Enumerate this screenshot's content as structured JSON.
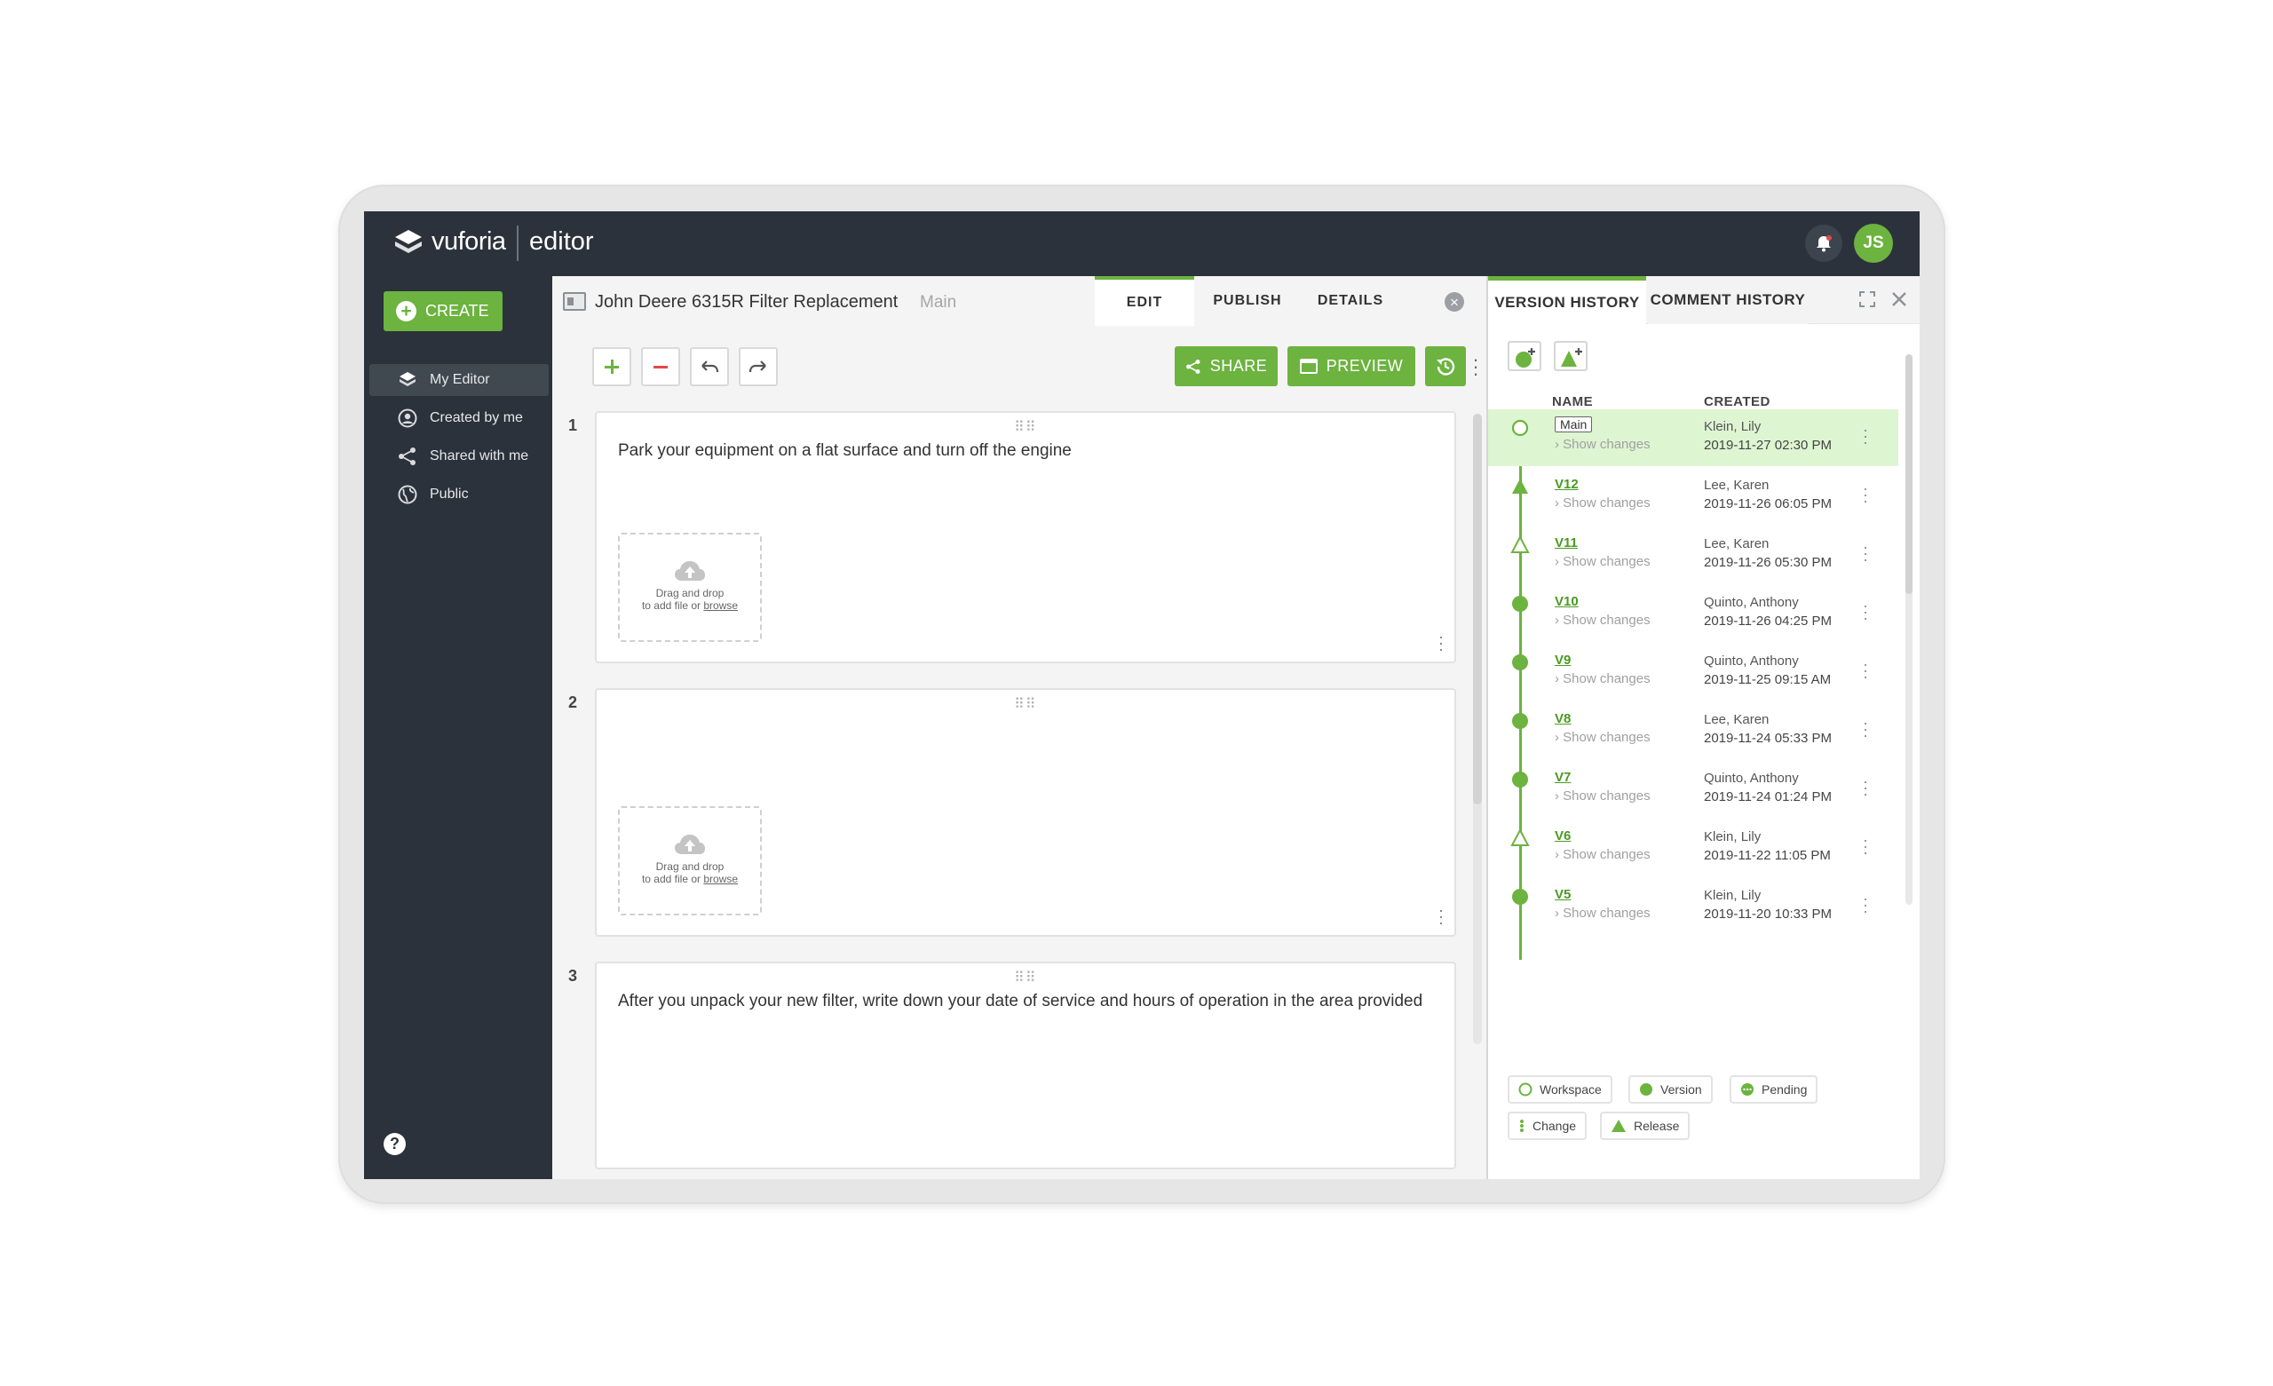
{
  "brand": {
    "name": "vuforia",
    "product": "editor"
  },
  "user": {
    "initials": "JS"
  },
  "colors": {
    "accent": "#6cb33f",
    "topbar": "#2b323b",
    "highlight": "#def5d2"
  },
  "sidebar": {
    "create_label": "CREATE",
    "items": [
      {
        "label": "My Editor",
        "icon": "layers-icon"
      },
      {
        "label": "Created by me",
        "icon": "user-circle-icon"
      },
      {
        "label": "Shared with me",
        "icon": "share-icon"
      },
      {
        "label": "Public",
        "icon": "globe-icon"
      }
    ],
    "help_label": "?"
  },
  "document": {
    "title": "John Deere 6315R Filter Replacement",
    "branch": "Main",
    "tabs": [
      "EDIT",
      "PUBLISH",
      "DETAILS"
    ],
    "actions": {
      "share": "SHARE",
      "preview": "PREVIEW"
    }
  },
  "steps": [
    {
      "number": "1",
      "text": "Park your equipment on a flat surface and turn off the engine",
      "dropzone": true
    },
    {
      "number": "2",
      "text": "",
      "dropzone": true
    },
    {
      "number": "3",
      "text": "After you unpack your new filter, write down your date of service and hours of operation in the area provided",
      "dropzone": false
    }
  ],
  "dropzone": {
    "line1": "Drag and drop",
    "line2": "to add file or",
    "link": "browse"
  },
  "history": {
    "tabs": [
      "VERSION HISTORY",
      "COMMENT HISTORY"
    ],
    "columns": {
      "name": "NAME",
      "created": "CREATED"
    },
    "show_changes": "Show changes",
    "versions": [
      {
        "name": "Main",
        "type": "workspace",
        "author": "Klein, Lily",
        "date": "2019-11-27 02:30 PM"
      },
      {
        "name": "V12",
        "type": "release-filled",
        "author": "Lee, Karen",
        "date": "2019-11-26 06:05 PM"
      },
      {
        "name": "V11",
        "type": "release-outline",
        "author": "Lee, Karen",
        "date": "2019-11-26 05:30 PM"
      },
      {
        "name": "V10",
        "type": "version",
        "author": "Quinto, Anthony",
        "date": "2019-11-26 04:25 PM"
      },
      {
        "name": "V9",
        "type": "version",
        "author": "Quinto, Anthony",
        "date": "2019-11-25 09:15 AM"
      },
      {
        "name": "V8",
        "type": "version",
        "author": "Lee, Karen",
        "date": "2019-11-24 05:33 PM"
      },
      {
        "name": "V7",
        "type": "version",
        "author": "Quinto, Anthony",
        "date": "2019-11-24 01:24 PM"
      },
      {
        "name": "V6",
        "type": "release-outline",
        "author": "Klein, Lily",
        "date": "2019-11-22 11:05 PM"
      },
      {
        "name": "V5",
        "type": "version",
        "author": "Klein, Lily",
        "date": "2019-11-20 10:33 PM"
      }
    ],
    "legend": {
      "workspace": "Workspace",
      "version": "Version",
      "pending": "Pending",
      "change": "Change",
      "release": "Release"
    }
  }
}
